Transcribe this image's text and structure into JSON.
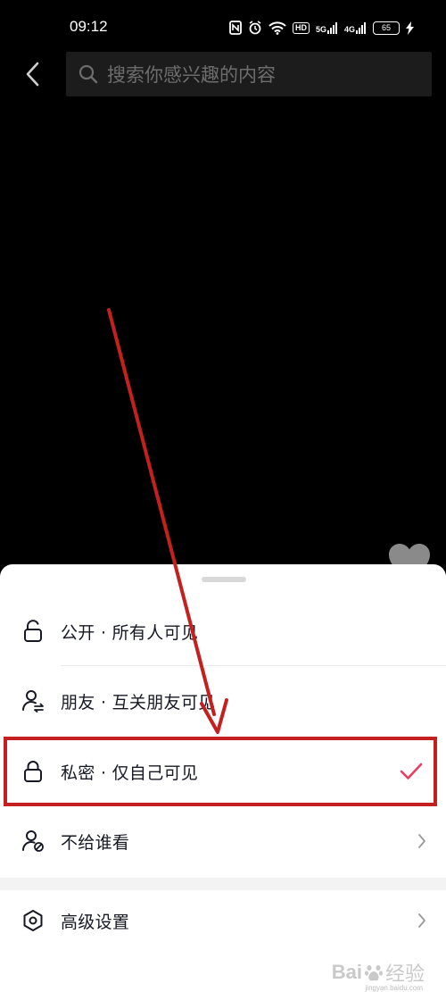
{
  "status_bar": {
    "time": "09:12",
    "net_5g": "5G",
    "net_4g": "4G",
    "hd": "HD",
    "battery": "65"
  },
  "search": {
    "placeholder": "搜索你感兴趣的内容"
  },
  "visibility_sheet": {
    "options": [
      {
        "label": "公开 · 所有人可见",
        "icon": "lock-open-icon"
      },
      {
        "label": "朋友 · 互关朋友可见",
        "icon": "friends-icon"
      },
      {
        "label": "私密 · 仅自己可见",
        "icon": "lock-icon",
        "selected": true
      },
      {
        "label": "不给谁看",
        "icon": "user-block-icon"
      }
    ],
    "advanced": {
      "label": "高级设置",
      "icon": "settings-hexagon-icon"
    }
  },
  "colors": {
    "check": "#ea3d64",
    "annotation": "#c4201f"
  },
  "watermark": {
    "main": "Bai",
    "sub": "经验",
    "url": "jingyan.baidu.com"
  }
}
